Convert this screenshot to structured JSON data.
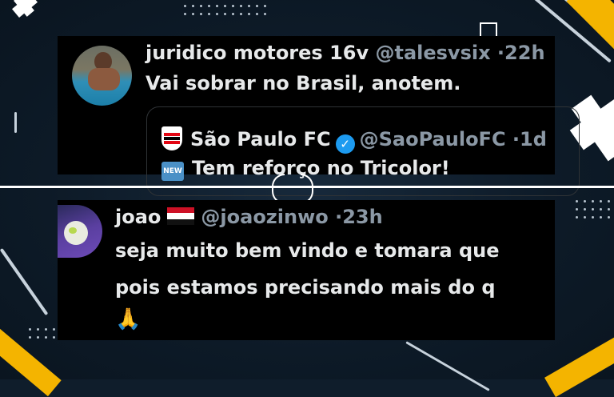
{
  "tweet1": {
    "display_name": "juridico motores 16v",
    "handle": "@talesvsix",
    "time": "22h",
    "text": "Vai sobrar no Brasil, anotem.",
    "quoted": {
      "display_name": "São Paulo FC",
      "handle": "@SaoPauloFC",
      "time": "1d",
      "text": "Tem reforço no Tricolor!",
      "badge_text": "NEW"
    }
  },
  "tweet2": {
    "display_name": "joao",
    "handle": "@joaozinwo",
    "time": "23h",
    "line1": "seja muito bem vindo e tomara que",
    "line2": "pois estamos precisando mais do q",
    "emoji": "🙏"
  },
  "separator": "·",
  "colors": {
    "accent_yellow": "#f4b400",
    "verified_blue": "#1d9bf0",
    "card_bg": "#000000",
    "muted_text": "#8b98a5"
  }
}
